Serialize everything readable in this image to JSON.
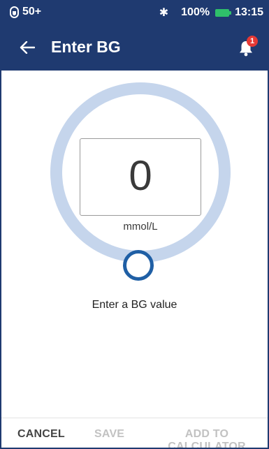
{
  "status_bar": {
    "pod_count": "50+",
    "battery_percent": "100%",
    "time": "13:15",
    "icons": [
      "pod-icon",
      "bluetooth-icon",
      "battery-charging-icon"
    ]
  },
  "app_bar": {
    "title": "Enter BG",
    "back_icon": "arrow-left-icon",
    "notification_icon": "bell-icon",
    "notification_count": "1"
  },
  "bg_entry": {
    "value": "0",
    "unit": "mmol/L",
    "prompt": "Enter a BG value"
  },
  "actions": {
    "cancel": "CANCEL",
    "save": "SAVE",
    "add_to_calculator": "ADD TO CALCULATOR",
    "save_enabled": false,
    "add_enabled": false
  },
  "colors": {
    "header": "#1f3a70",
    "dial_ring": "#c5d5ec",
    "slider_thumb": "#1f5fa5",
    "badge": "#e53935",
    "battery": "#2fc06a"
  }
}
